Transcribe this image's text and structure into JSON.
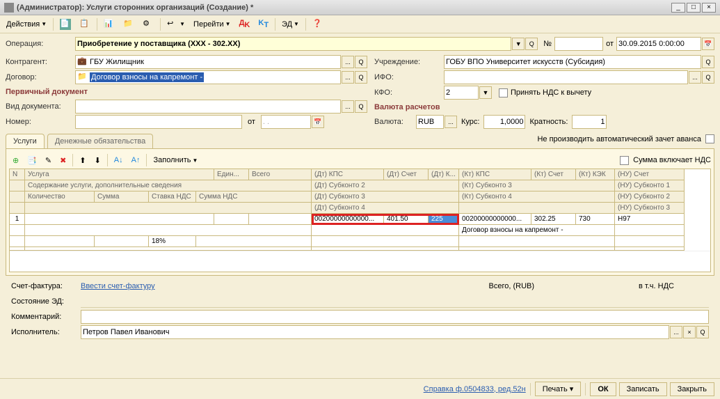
{
  "title": "(Администратор): Услуги сторонних организаций (Создание) *",
  "toolbar": {
    "actions": "Действия",
    "goto": "Перейти",
    "ed": "ЭД"
  },
  "form": {
    "operation_lbl": "Операция:",
    "operation": "Приобретение у поставщика (XXX - 302.XX)",
    "num_lbl": "№",
    "ot_lbl": "от",
    "date": "30.09.2015 0:00:00",
    "contragent_lbl": "Контрагент:",
    "contragent": "ГБУ Жилищник",
    "uchrezhdenie_lbl": "Учреждение:",
    "uchrezhdenie": "ГОБУ ВПО Университет искусств (Субсидия)",
    "dogovor_lbl": "Договор:",
    "dogovor": "Договор  взносы на капремонт -",
    "ifo_lbl": "ИФО:",
    "kfo_lbl": "КФО:",
    "kfo": "2",
    "nds_check": "Принять НДС к вычету",
    "primary_doc": "Первичный документ",
    "valuta_section": "Валюта расчетов",
    "vid_dok_lbl": "Вид документа:",
    "nomer_lbl": "Номер:",
    "ot2": "от",
    "valuta_lbl": "Валюта:",
    "valuta": "RUB",
    "kurs_lbl": "Курс:",
    "kurs": "1,0000",
    "kratnost_lbl": "Кратность:",
    "kratnost": "1"
  },
  "tabs": {
    "uslugi": "Услуги",
    "den": "Денежные обязательства",
    "no_auto": "Не производить автоматический зачет аванса",
    "sum_nds": "Сумма включает НДС",
    "zapolnit": "Заполнить"
  },
  "grid": {
    "h_n": "N",
    "h_usluga": "Услуга",
    "h_edin": "Един...",
    "h_vsego": "Всего",
    "h_dt_kps": "(Дт) КПС",
    "h_dt_schet": "(Дт) Счет",
    "h_dt_k": "(Дт) К...",
    "h_kt_kps": "(Кт) КПС",
    "h_kt_schet": "(Кт) Счет",
    "h_kt_kek": "(Кт) КЭК",
    "h_nu_schet": "(НУ) Счет",
    "h_soderzh": "Содержание услуги, дополнительные сведения",
    "h_dt_sub2": "(Дт) Субконто 2",
    "h_kt_sub3": "(Кт) Субконто 3",
    "h_nu_sub1": "(НУ) Субконто 1",
    "h_kol": "Количество",
    "h_summa": "Сумма",
    "h_stavka": "Ставка НДС",
    "h_summa_nds": "Сумма НДС",
    "h_dt_sub3": "(Дт) Субконто 3",
    "h_kt_sub4": "(Кт) Субконто 4",
    "h_nu_sub2": "(НУ) Субконто 2",
    "h_dt_sub4": "(Дт) Субконто 4",
    "h_nu_sub3": "(НУ) Субконто 3",
    "r_n": "1",
    "r_dt_kps": "00200000000000...",
    "r_dt_schet": "401.50",
    "r_dt_k": "225",
    "r_kt_kps": "00200000000000...",
    "r_kt_schet": "302.25",
    "r_kt_kek": "730",
    "r_nu_schet": "H97",
    "r_kt_sub3": "Договор  взносы на капремонт -",
    "r_stavka": "18%"
  },
  "bottom": {
    "schet_faktura_lbl": "Счет-фактура:",
    "schet_faktura_link": "Ввести счет-фактуру",
    "vsego": "Всего, (RUB)",
    "vtch": "в т.ч. НДС",
    "sost_ed": "Состояние ЭД:",
    "comment_lbl": "Комментарий:",
    "ispolnitel_lbl": "Исполнитель:",
    "ispolnitel": "Петров Павел Иванович"
  },
  "footer": {
    "spravka": "Справка ф.0504833, ред.52н",
    "pechat": "Печать",
    "ok": "ОК",
    "zapisat": "Записать",
    "zakryt": "Закрыть"
  }
}
